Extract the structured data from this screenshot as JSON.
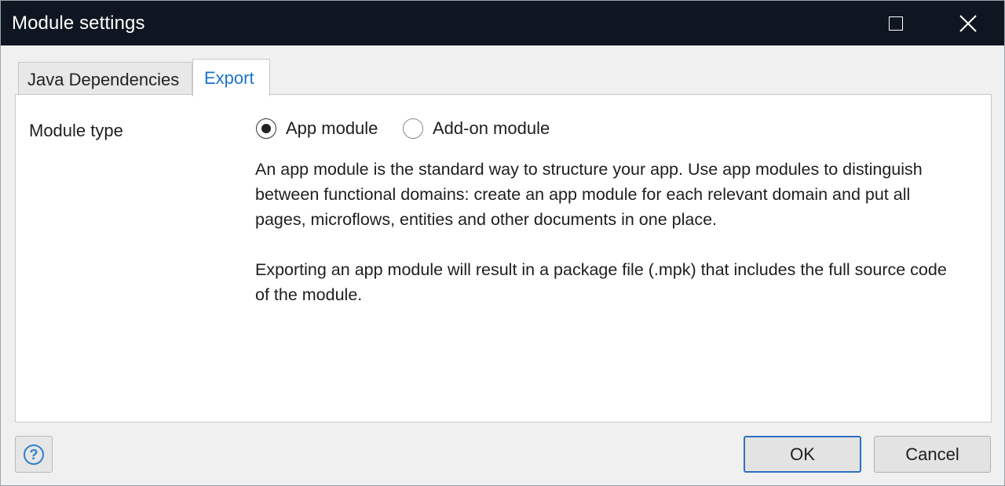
{
  "window": {
    "title": "Module settings",
    "maximize_icon": "square-outline",
    "close_icon": "x-glyph"
  },
  "tabs": [
    {
      "label": "Java Dependencies",
      "active": false
    },
    {
      "label": "Export",
      "active": true
    }
  ],
  "export": {
    "module_type_label": "Module type",
    "options": [
      {
        "label": "App module",
        "checked": true
      },
      {
        "label": "Add-on module",
        "checked": false
      }
    ],
    "description_1": "An app module is the standard way to structure your app. Use app modules to distinguish between functional domains: create an app module for each relevant domain and put all pages, microflows, entities and other documents in one place.",
    "description_2": "Exporting an app module will result in a package file (.mpk) that includes the full source code of the module."
  },
  "footer": {
    "help_glyph": "?",
    "ok_label": "OK",
    "cancel_label": "Cancel"
  },
  "colors": {
    "titlebar": "#0e1621",
    "accent": "#1a73c9",
    "ok_border": "#2f6fc0"
  }
}
